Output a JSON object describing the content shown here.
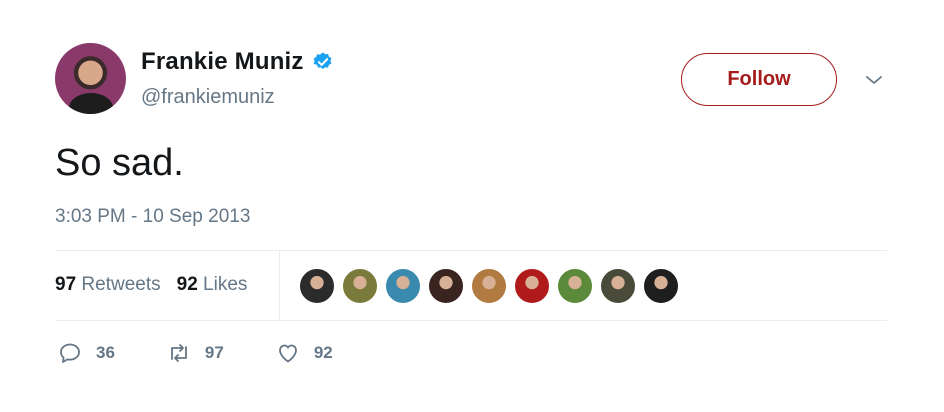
{
  "author": {
    "display_name": "Frankie Muniz",
    "handle": "@frankiemuniz",
    "verified_icon": "verified-badge-icon",
    "avatar_icon": "avatar"
  },
  "header": {
    "follow_label": "Follow",
    "menu_icon": "chevron-down-icon"
  },
  "tweet": {
    "text": "So sad.",
    "timestamp": "3:03 PM - 10 Sep 2013"
  },
  "stats": {
    "retweets_count": "97",
    "retweets_label": "Retweets",
    "likes_count": "92",
    "likes_label": "Likes"
  },
  "likers": [
    {
      "color": "#2b2b2b"
    },
    {
      "color": "#7a7a3a"
    },
    {
      "color": "#3a8ab0"
    },
    {
      "color": "#3a2420"
    },
    {
      "color": "#b07a40"
    },
    {
      "color": "#b01a1a"
    },
    {
      "color": "#5a8a3a"
    },
    {
      "color": "#4a4a3a"
    },
    {
      "color": "#1e1e1e"
    }
  ],
  "actions": {
    "reply_count": "36",
    "retweet_count": "97",
    "like_count": "92"
  },
  "colors": {
    "accent": "#a51c1c",
    "verified": "#1da1f2",
    "muted": "#657786"
  }
}
